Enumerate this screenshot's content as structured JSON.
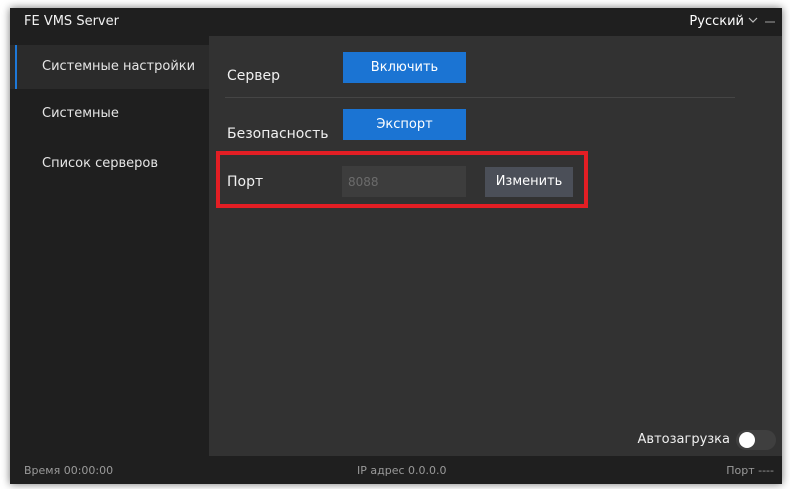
{
  "window": {
    "title": "FE VMS Server",
    "language": "Русский"
  },
  "sidebar": {
    "items": [
      {
        "label": "Системные настройки",
        "active": true
      },
      {
        "label": "Системные",
        "active": false
      },
      {
        "label": "Список серверов",
        "active": false
      }
    ]
  },
  "settings": {
    "server": {
      "label": "Сервер",
      "button": "Включить"
    },
    "security": {
      "label": "Безопасность",
      "button": "Экспорт"
    },
    "port": {
      "label": "Порт",
      "placeholder": "8088",
      "value": "",
      "button": "Изменить"
    }
  },
  "autoload": {
    "label": "Автозагрузка",
    "enabled": false
  },
  "status": {
    "time": "Время  00:00:00",
    "ip": "IP адрес  0.0.0.0",
    "port": "Порт  ----"
  },
  "colors": {
    "accent": "#1b74d3",
    "highlight": "#e31e24",
    "panel": "#323232",
    "sidebar": "#1f1f1f"
  }
}
